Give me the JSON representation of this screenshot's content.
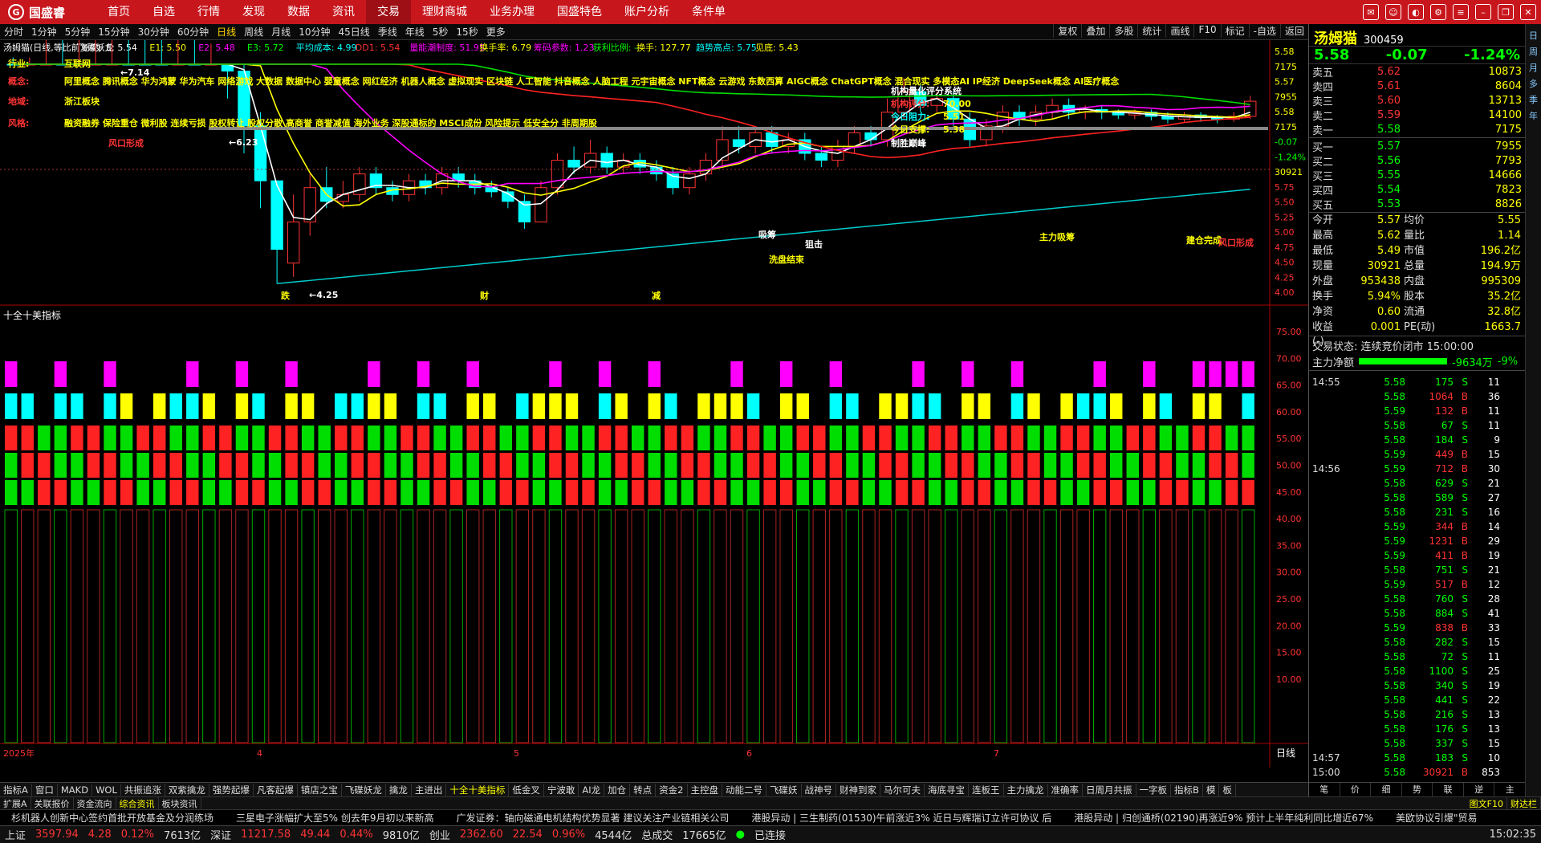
{
  "app": {
    "logo": "国盛睿",
    "menu": [
      "首页",
      "自选",
      "行情",
      "发现",
      "数据",
      "资讯",
      "交易",
      "理财商城",
      "业务办理",
      "国盛特色",
      "账户分析",
      "条件单"
    ],
    "active_menu": "交易"
  },
  "periods": [
    "分时",
    "1分钟",
    "5分钟",
    "15分钟",
    "30分钟",
    "60分钟",
    "日线",
    "周线",
    "月线",
    "10分钟",
    "45日线",
    "季线",
    "年线",
    "5秒",
    "15秒",
    "更多"
  ],
  "active_period": "日线",
  "right_tools": [
    "复权",
    "叠加",
    "多股",
    "统计",
    "画线",
    "F10",
    "标记",
    "-自选",
    "返回"
  ],
  "indicator_line": [
    {
      "t": "汤姆猫(日线,等比前复权)",
      "c": "#ffffff"
    },
    {
      "t": "飞碟妖龙",
      "c": "#ffffff"
    },
    {
      "t": "E: 5.54",
      "c": "#ffffff"
    },
    {
      "t": "E1: 5.50",
      "c": "#ffff00"
    },
    {
      "t": "E2: 5.48",
      "c": "#ff00ff"
    },
    {
      "t": "E3: 5.72",
      "c": "#00ff00"
    },
    {
      "t": "平均成本: 4.99",
      "c": "#00ffff"
    },
    {
      "t": "DD1: 5.54",
      "c": "#ff3333"
    },
    {
      "t": "量能潮制度: 51.95",
      "c": "#ff00ff"
    },
    {
      "t": "换手率: 6.79",
      "c": "#ffff00"
    },
    {
      "t": "筹码参数: 1.23",
      "c": "#ff00ff"
    },
    {
      "t": "获利比例: -",
      "c": "#00ff00"
    },
    {
      "t": "换手: 127.77",
      "c": "#ffff00"
    },
    {
      "t": "趋势高点: 5.75",
      "c": "#00ffff"
    },
    {
      "t": "见底: 5.43",
      "c": "#ffff00"
    }
  ],
  "overlay": {
    "industry_label": "行业:",
    "industry": "互联网",
    "concept_label": "概念:",
    "concepts1": "阿里概念 腾讯概念 华为鸿蒙 华为汽车 网络游戏 大数据 数据中心 婴童概念 网红经济 机器人概念 虚拟现实 区块链 人工智能 抖音概念 人脑工程 元宇宙概念 NFT概念 云游戏 东数西算 AIGC概念 ChatGPT概念 混合现实 多模态AI IP经济 DeepSeek概念 AI医疗概念",
    "region_label": "地域:",
    "region": "浙江板块",
    "style_label": "风格:",
    "styles": "融资融券 保险重仓 微利股 连续亏损 股权转让 股权分散 高商誉 商誉减值 海外业务 深股通标的 MSCI成份 风险提示 低安全分 非周期股",
    "rating_title": "机构量化评分系统",
    "rating_label": "机构评分:",
    "rating_value": "70.00",
    "resist_label": "今日阻力:",
    "resist_value": "5.51",
    "support_label": "今日支撑:",
    "support_value": "5.38",
    "peak": "制胜巅峰"
  },
  "chart_data": {
    "type": "candlestick",
    "title": "汤姆猫(日线,等比前复权)",
    "y_ticks": [
      "5.58",
      "7175",
      "5.57",
      "7955",
      "5.58",
      "7175",
      "-0.07",
      "-1.24%",
      "30921",
      "5.75",
      "5.50",
      "5.25",
      "5.00",
      "4.75",
      "4.50",
      "4.25",
      "4.00"
    ],
    "price_range": [
      4.0,
      5.85
    ],
    "max_label": "7.14",
    "min_label": "4.25",
    "mid_label": "6.23",
    "annotations": [
      "风口形成",
      "吸筹",
      "洗盘结束",
      "狙击",
      "主力吸筹",
      "建仓完成",
      "风口形成"
    ],
    "x_markers": [
      "跌",
      "财",
      "减"
    ],
    "candles": [
      [
        6.2,
        6.0,
        6.3,
        5.9
      ],
      [
        6.0,
        6.2,
        6.3,
        5.9
      ],
      [
        6.2,
        6.4,
        6.5,
        6.1
      ],
      [
        6.4,
        6.3,
        6.6,
        6.2
      ],
      [
        6.3,
        6.5,
        6.7,
        6.2
      ],
      [
        6.5,
        6.7,
        6.9,
        6.4
      ],
      [
        6.7,
        7.0,
        7.14,
        6.6
      ],
      [
        7.0,
        6.8,
        7.1,
        6.6
      ],
      [
        6.8,
        6.6,
        6.9,
        6.4
      ],
      [
        6.6,
        6.3,
        6.7,
        6.1
      ],
      [
        6.3,
        6.4,
        6.6,
        6.2
      ],
      [
        6.4,
        6.2,
        6.5,
        6.1
      ],
      [
        6.2,
        6.23,
        6.4,
        6.0
      ],
      [
        6.2,
        5.8,
        6.2,
        5.6
      ],
      [
        5.8,
        5.4,
        5.9,
        5.2
      ],
      [
        5.4,
        5.0,
        5.5,
        4.8
      ],
      [
        5.0,
        4.5,
        5.0,
        4.25
      ],
      [
        4.4,
        4.7,
        4.9,
        4.3
      ],
      [
        4.7,
        4.95,
        5.05,
        4.6
      ],
      [
        4.95,
        4.85,
        5.1,
        4.8
      ],
      [
        4.85,
        4.9,
        5.0,
        4.8
      ],
      [
        4.9,
        5.05,
        5.1,
        4.85
      ],
      [
        5.05,
        4.95,
        5.1,
        4.9
      ],
      [
        4.95,
        4.9,
        5.0,
        4.85
      ],
      [
        4.9,
        5.0,
        5.05,
        4.85
      ],
      [
        5.0,
        4.95,
        5.05,
        4.9
      ],
      [
        4.95,
        5.05,
        5.1,
        4.9
      ],
      [
        5.05,
        5.0,
        5.1,
        4.95
      ],
      [
        5.0,
        4.95,
        5.05,
        4.9
      ],
      [
        4.95,
        4.92,
        5.0,
        4.88
      ],
      [
        4.92,
        4.85,
        4.95,
        4.8
      ],
      [
        4.85,
        4.7,
        4.9,
        4.65
      ],
      [
        4.7,
        4.95,
        5.0,
        4.7
      ],
      [
        4.95,
        5.15,
        5.2,
        4.9
      ],
      [
        5.15,
        5.1,
        5.25,
        5.05
      ],
      [
        5.1,
        5.2,
        5.3,
        5.05
      ],
      [
        5.2,
        5.1,
        5.25,
        5.05
      ],
      [
        5.1,
        5.15,
        5.2,
        5.05
      ],
      [
        5.15,
        5.1,
        5.2,
        5.05
      ],
      [
        5.1,
        5.05,
        5.15,
        5.0
      ],
      [
        5.05,
        4.95,
        5.1,
        4.9
      ],
      [
        4.95,
        5.05,
        5.1,
        4.9
      ],
      [
        5.05,
        5.15,
        5.2,
        5.0
      ],
      [
        5.15,
        5.3,
        5.4,
        5.1
      ],
      [
        5.3,
        5.25,
        5.4,
        5.2
      ],
      [
        5.25,
        5.35,
        5.4,
        5.2
      ],
      [
        5.35,
        5.25,
        5.4,
        5.2
      ],
      [
        5.25,
        5.3,
        5.35,
        5.2
      ],
      [
        5.3,
        5.2,
        5.35,
        5.15
      ],
      [
        5.2,
        5.15,
        5.25,
        5.1
      ],
      [
        5.15,
        5.25,
        5.3,
        5.1
      ],
      [
        5.25,
        5.35,
        5.4,
        5.2
      ],
      [
        5.35,
        5.3,
        5.4,
        5.25
      ],
      [
        5.3,
        5.5,
        5.6,
        5.25
      ],
      [
        5.5,
        5.65,
        5.75,
        5.45
      ],
      [
        5.65,
        5.55,
        5.7,
        5.5
      ],
      [
        5.55,
        5.6,
        5.65,
        5.5
      ],
      [
        5.6,
        5.45,
        5.65,
        5.4
      ],
      [
        5.45,
        5.3,
        5.5,
        5.25
      ],
      [
        5.3,
        5.4,
        5.45,
        5.25
      ],
      [
        5.4,
        5.5,
        5.55,
        5.35
      ],
      [
        5.5,
        5.45,
        5.55,
        5.4
      ],
      [
        5.45,
        5.5,
        5.55,
        5.4
      ],
      [
        5.5,
        5.55,
        5.6,
        5.45
      ],
      [
        5.55,
        5.5,
        5.6,
        5.45
      ],
      [
        5.5,
        5.52,
        5.55,
        5.45
      ],
      [
        5.52,
        5.5,
        5.55,
        5.45
      ],
      [
        5.5,
        5.48,
        5.52,
        5.45
      ],
      [
        5.48,
        5.5,
        5.52,
        5.45
      ],
      [
        5.5,
        5.47,
        5.52,
        5.44
      ],
      [
        5.47,
        5.45,
        5.5,
        5.42
      ],
      [
        5.45,
        5.48,
        5.5,
        5.42
      ],
      [
        5.48,
        5.46,
        5.5,
        5.43
      ],
      [
        5.46,
        5.45,
        5.48,
        5.42
      ],
      [
        5.45,
        5.47,
        5.5,
        5.43
      ],
      [
        5.47,
        5.58,
        5.62,
        5.45
      ]
    ]
  },
  "sub_indicator": {
    "name": "十全十美指标",
    "y_ticks": [
      "75.00",
      "70.00",
      "65.00",
      "60.00",
      "55.00",
      "50.00",
      "45.00",
      "40.00",
      "35.00",
      "30.00",
      "25.00",
      "20.00",
      "15.00",
      "10.00"
    ]
  },
  "x_labels": [
    "2025年",
    "4",
    "5",
    "6",
    "7"
  ],
  "side_period": "日线",
  "quote": {
    "name": "汤姆猫",
    "code": "300459",
    "price": "5.58",
    "change": "-0.07",
    "pct": "-1.24%",
    "asks": [
      [
        "卖五",
        "5.62",
        "10873"
      ],
      [
        "卖四",
        "5.61",
        "8604"
      ],
      [
        "卖三",
        "5.60",
        "13713"
      ],
      [
        "卖二",
        "5.59",
        "14100"
      ],
      [
        "卖一",
        "5.58",
        "7175"
      ]
    ],
    "bids": [
      [
        "买一",
        "5.57",
        "7955"
      ],
      [
        "买二",
        "5.56",
        "7793"
      ],
      [
        "买三",
        "5.55",
        "14666"
      ],
      [
        "买四",
        "5.54",
        "7823"
      ],
      [
        "买五",
        "5.53",
        "8826"
      ]
    ],
    "stats": [
      [
        "今开",
        "5.57",
        "均价",
        "5.55"
      ],
      [
        "最高",
        "5.62",
        "量比",
        "1.14"
      ],
      [
        "最低",
        "5.49",
        "市值",
        "196.2亿"
      ],
      [
        "现量",
        "30921",
        "总量",
        "194.9万"
      ],
      [
        "外盘",
        "953438",
        "内盘",
        "995309"
      ],
      [
        "换手",
        "5.94%",
        "股本",
        "35.2亿"
      ],
      [
        "净资",
        "0.60",
        "流通",
        "32.8亿"
      ],
      [
        "收益(-)",
        "0.001",
        "PE(动)",
        "1663.7"
      ]
    ],
    "trade_state": "交易状态: 连续竞价闭市 15:00:00",
    "main_net_label": "主力净额",
    "main_net": "-9634万",
    "main_net_pct": "-9%",
    "ticks": [
      [
        "14:55",
        "5.58",
        "175",
        "S",
        "11"
      ],
      [
        "",
        "5.58",
        "1064",
        "B",
        "36"
      ],
      [
        "",
        "5.59",
        "132",
        "B",
        "11"
      ],
      [
        "",
        "5.58",
        "67",
        "S",
        "11"
      ],
      [
        "",
        "5.58",
        "184",
        "S",
        "9"
      ],
      [
        "",
        "5.59",
        "449",
        "B",
        "15"
      ],
      [
        "14:56",
        "5.59",
        "712",
        "B",
        "30"
      ],
      [
        "",
        "5.58",
        "629",
        "S",
        "21"
      ],
      [
        "",
        "5.58",
        "589",
        "S",
        "27"
      ],
      [
        "",
        "5.58",
        "231",
        "S",
        "16"
      ],
      [
        "",
        "5.59",
        "344",
        "B",
        "14"
      ],
      [
        "",
        "5.59",
        "1231",
        "B",
        "29"
      ],
      [
        "",
        "5.59",
        "411",
        "B",
        "19"
      ],
      [
        "",
        "5.58",
        "751",
        "S",
        "21"
      ],
      [
        "",
        "5.59",
        "517",
        "B",
        "12"
      ],
      [
        "",
        "5.58",
        "760",
        "S",
        "28"
      ],
      [
        "",
        "5.58",
        "884",
        "S",
        "41"
      ],
      [
        "",
        "5.59",
        "838",
        "B",
        "33"
      ],
      [
        "",
        "5.58",
        "282",
        "S",
        "15"
      ],
      [
        "",
        "5.58",
        "72",
        "S",
        "11"
      ],
      [
        "",
        "5.58",
        "1100",
        "S",
        "25"
      ],
      [
        "",
        "5.58",
        "340",
        "S",
        "19"
      ],
      [
        "",
        "5.58",
        "441",
        "S",
        "22"
      ],
      [
        "",
        "5.58",
        "216",
        "S",
        "13"
      ],
      [
        "",
        "5.58",
        "176",
        "S",
        "13"
      ],
      [
        "",
        "5.58",
        "337",
        "S",
        "15"
      ],
      [
        "14:57",
        "5.58",
        "183",
        "S",
        "10"
      ],
      [
        "15:00",
        "5.58",
        "30921",
        "B",
        "853"
      ]
    ]
  },
  "right_side_icons": [
    "日",
    "周",
    "月",
    "多",
    "季",
    "年"
  ],
  "panel_tabs": [
    "笔",
    "价",
    "细",
    "势",
    "联",
    "逆",
    "主"
  ],
  "bottom_tabs": [
    "指标A",
    "窗口",
    "MAKD",
    "WOL",
    "共振追涨",
    "双紫擒龙",
    "强势起爆",
    "凡客起爆",
    "镇店之宝",
    "飞碟妖龙",
    "擒龙",
    "主进出",
    "十全十美指标",
    "低金叉",
    "宁波敢",
    "AI龙",
    "加仓",
    "转点",
    "资金2",
    "主控盘",
    "动能二号",
    "飞碟妖",
    "战神号",
    "财神到家",
    "马尔可夫",
    "海底寻宝",
    "连板王",
    "主力擒龙",
    "准确率",
    "日周月共振",
    "一字板",
    "指标B",
    "模",
    "板"
  ],
  "active_bottom_tab": "十全十美指标",
  "sub_tabs": [
    "扩展A",
    "关联报价",
    "资金流向",
    "综合资讯",
    "板块资讯"
  ],
  "active_sub_tab": "综合资讯",
  "sub_right": [
    "图文F10",
    "财达栏"
  ],
  "news": [
    "杉机器人创新中心签约首批开放基金及分润练场",
    "三星电子涨幅扩大至5% 创去年9月初以来新高",
    "广发证券：轴向磁通电机结构优势显著 建议关注产业链相关公司",
    "港股异动 | 三生制药(01530)午前涨近3% 近日与辉瑞订立许可协议 后",
    "港股异动 | 归创通桥(02190)再涨近9% 预计上半年纯利同比增近67%",
    "美欧协议引爆\"贸易"
  ],
  "status": {
    "sh_label": "上证",
    "sh": "3597.94",
    "sh_chg": "4.28",
    "sh_pct": "0.12%",
    "sh_amt": "7613亿",
    "sz_label": "深证",
    "sz": "11217.58",
    "sz_chg": "49.44",
    "sz_pct": "0.44%",
    "sz_amt": "9810亿",
    "cy_label": "创业",
    "cy": "2362.60",
    "cy_chg": "22.54",
    "cy_pct": "0.96%",
    "cy_amt": "4544亿",
    "total_label": "总成交",
    "total": "17665亿",
    "conn": "已连接",
    "time": "15:02:35"
  }
}
